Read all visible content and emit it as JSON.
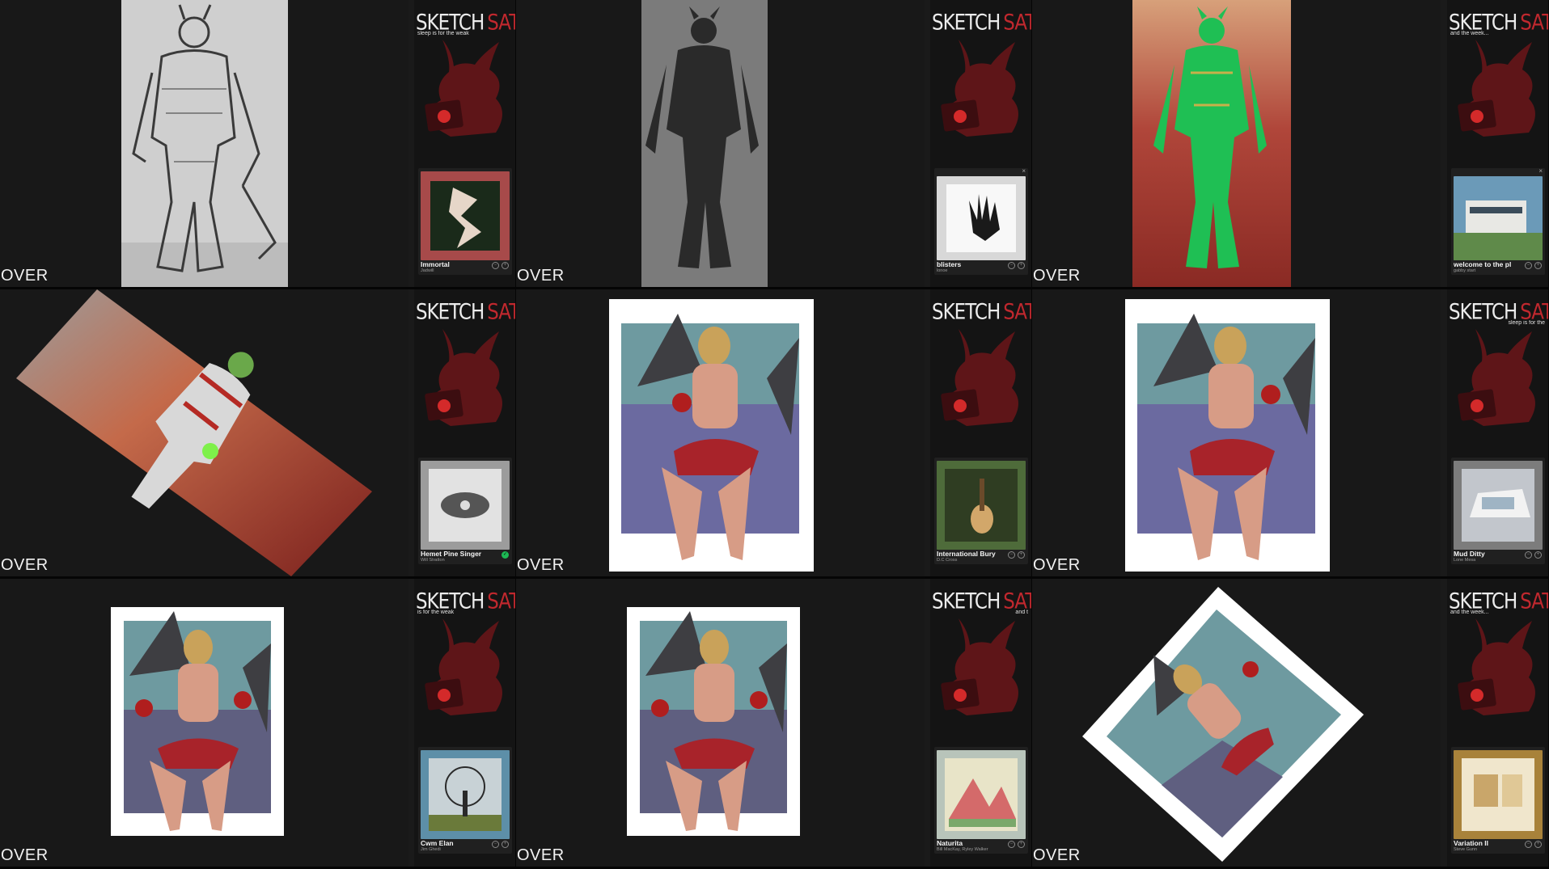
{
  "overlay_label": "OVER",
  "brand": {
    "word1": "SKETCH",
    "word2": "SATURDAY",
    "accent": "#c0282e"
  },
  "cells": [
    {
      "tagline": "sleep is for the weak",
      "track": "Immortal",
      "artist": "Jadwill",
      "album_icon": "abstract-art-icon",
      "album_bg": "#a74a4a",
      "controls": "plain"
    },
    {
      "tagline": "",
      "track": "blisters",
      "artist": "lonoe",
      "album_icon": "hand-art-icon",
      "album_bg": "#d8d8d8",
      "controls": "plain"
    },
    {
      "tagline": "and the week...",
      "track": "welcome to the pl",
      "artist": "gabby start",
      "album_icon": "building-photo-icon",
      "album_bg": "#6b9ab8",
      "controls": "plain"
    },
    {
      "tagline": "",
      "track": "Hemet Pine Singer",
      "artist": "Will Stratton",
      "album_icon": "hand-photo-icon",
      "album_bg": "#9c9c9c",
      "controls": "check"
    },
    {
      "tagline": "",
      "track": "International Bury",
      "artist": "D.C Cross",
      "album_icon": "guitar-photo-icon",
      "album_bg": "#4e6b3a",
      "controls": "plain"
    },
    {
      "tagline": "sleep is for the",
      "track": "Mud Ditty",
      "artist": "Lone Mesa",
      "album_icon": "car-photo-icon",
      "album_bg": "#7c7c7c",
      "controls": "plain"
    },
    {
      "tagline": "is for the weak",
      "track": "Cwm Elan",
      "artist": "Jim Ghedi",
      "album_icon": "tree-photo-icon",
      "album_bg": "#5d8fa8",
      "controls": "plain"
    },
    {
      "tagline": "and t",
      "track": "Naturita",
      "artist": "Bill MacKay, Ryley Walker",
      "album_icon": "mountain-art-icon",
      "album_bg": "#b8c4ba",
      "controls": "plain"
    },
    {
      "tagline": "and the week...",
      "track": "Variation II",
      "artist": "Steve Gunn",
      "album_icon": "interior-photo-icon",
      "album_bg": "#a8823a",
      "controls": "plain"
    }
  ]
}
